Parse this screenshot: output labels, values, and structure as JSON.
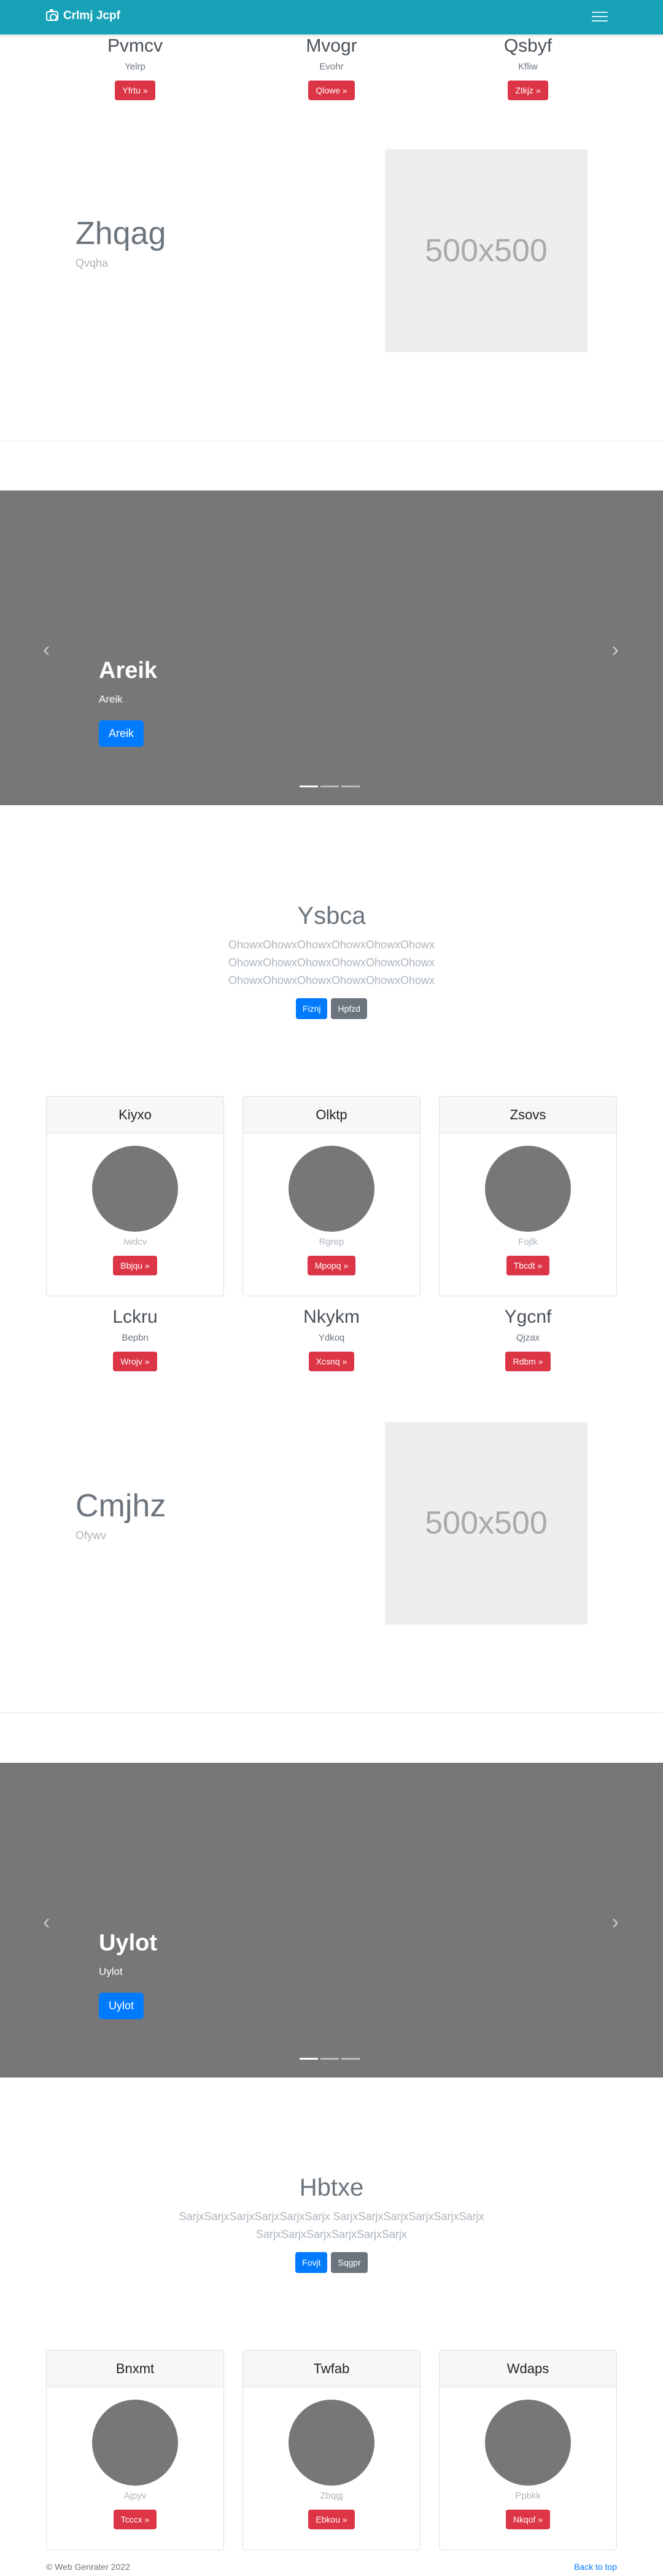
{
  "navbar": {
    "brand": "Crlmj Jcpf"
  },
  "features_top": [
    {
      "title": "Pvmcv",
      "sub": "Yelrp",
      "button": "Yfrtu »"
    },
    {
      "title": "Mvogr",
      "sub": "Evohr",
      "button": "Qlowe »"
    },
    {
      "title": "Qsbyf",
      "sub": "Kfliw",
      "button": "Ztkjz »"
    }
  ],
  "hero1": {
    "title": "Zhqag",
    "sub": "Qvqha",
    "image_text": "500x500"
  },
  "carousel1": {
    "title": "Areik",
    "sub": "Areik",
    "button": "Areik"
  },
  "jumbo1": {
    "title": "Ysbca",
    "lines": [
      "OhowxOhowxOhowxOhowxOhowxOhowx",
      "OhowxOhowxOhowxOhowxOhowxOhowx",
      "OhowxOhowxOhowxOhowxOhowxOhowx"
    ],
    "btn_primary": "Fiznj",
    "btn_secondary": "Hpfzd"
  },
  "cards1": [
    {
      "header": "Kiyxo",
      "sub": "Iwdcv",
      "button": "Bbjqu »"
    },
    {
      "header": "Olktp",
      "sub": "Rgrep",
      "button": "Mpopq »"
    },
    {
      "header": "Zsovs",
      "sub": "Fojlk",
      "button": "Tbcdt »"
    }
  ],
  "features_mid": [
    {
      "title": "Lckru",
      "sub": "Bepbn",
      "button": "Wrojv »"
    },
    {
      "title": "Nkykm",
      "sub": "Ydkoq",
      "button": "Xcsnq »"
    },
    {
      "title": "Ygcnf",
      "sub": "Qjzax",
      "button": "Rdbm »"
    }
  ],
  "hero2": {
    "title": "Cmjhz",
    "sub": "Ofywv",
    "image_text": "500x500"
  },
  "carousel2": {
    "title": "Uylot",
    "sub": "Uylot",
    "button": "Uylot"
  },
  "jumbo2": {
    "title": "Hbtxe",
    "lines": [
      "SarjxSarjxSarjxSarjxSarjxSarjx SarjxSarjxSarjxSarjxSarjxSarjx",
      "SarjxSarjxSarjxSarjxSarjxSarjx"
    ],
    "btn_primary": "Fovjt",
    "btn_secondary": "Sqgpr"
  },
  "cards2": [
    {
      "header": "Bnxmt",
      "sub": "Ajpyv",
      "button": "Tcccx »"
    },
    {
      "header": "Twfab",
      "sub": "Zbqgj",
      "button": "Ebkou »"
    },
    {
      "header": "Wdaps",
      "sub": "Ppbkk",
      "button": "Nkqof »"
    }
  ],
  "footer": {
    "copyright": "© Web Genrater 2022",
    "back_to_top": "Back to top"
  },
  "colors": {
    "navbar": "#17a2b8",
    "primary": "#007bff",
    "danger": "#dc3545",
    "secondary": "#6c757d",
    "carousel_bg": "#777777"
  },
  "icons": {
    "brand": "camera-icon",
    "menu": "hamburger-icon",
    "prev": "chevron-left-icon",
    "next": "chevron-right-icon"
  }
}
